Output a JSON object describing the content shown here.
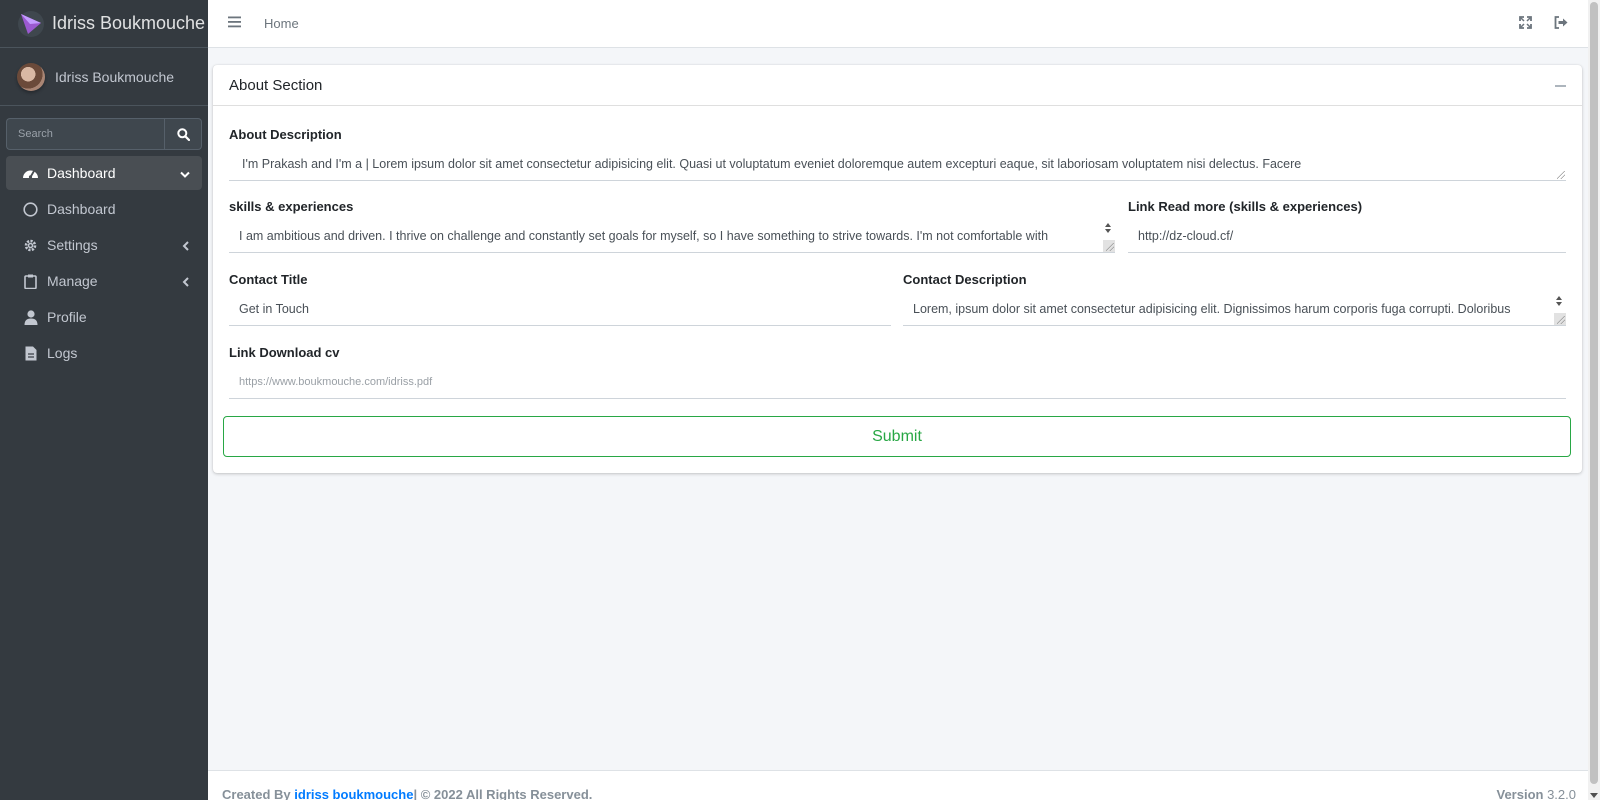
{
  "brand": {
    "name": "Idriss Boukmouche"
  },
  "user": {
    "name": "Idriss Boukmouche"
  },
  "search": {
    "placeholder": "Search"
  },
  "sidebar": {
    "items": [
      {
        "label": "Dashboard",
        "icon": "tachometer-icon",
        "active": true,
        "arrow": "chevron-down"
      },
      {
        "label": "Dashboard",
        "icon": "circle-icon"
      },
      {
        "label": "Settings",
        "icon": "gear-icon",
        "arrow": "chevron-left"
      },
      {
        "label": "Manage",
        "icon": "clipboard-icon",
        "arrow": "chevron-left"
      },
      {
        "label": "Profile",
        "icon": "user-icon"
      },
      {
        "label": "Logs",
        "icon": "file-icon"
      }
    ]
  },
  "topbar": {
    "home": "Home"
  },
  "card": {
    "title": "About Section",
    "about_description": {
      "label": "About Description",
      "value": "I'm Prakash and I'm a | Lorem ipsum dolor sit amet consectetur adipisicing elit. Quasi ut voluptatum eveniet doloremque autem excepturi eaque, sit laboriosam voluptatem nisi delectus. Facere"
    },
    "skills": {
      "label": "skills & experiences",
      "value": "I am ambitious and driven. I thrive on challenge and constantly set goals for myself, so I have something to strive towards. I'm not comfortable with"
    },
    "link_read_more": {
      "label": "Link Read more (skills & experiences)",
      "value": "http://dz-cloud.cf/"
    },
    "contact_title": {
      "label": "Contact Title",
      "value": "Get in Touch"
    },
    "contact_description": {
      "label": "Contact Description",
      "value": "Lorem, ipsum dolor sit amet consectetur adipisicing elit. Dignissimos harum corporis fuga corrupti. Doloribus"
    },
    "link_download_cv": {
      "label": "Link Download cv",
      "placeholder": "https://www.boukmouche.com/idriss.pdf"
    },
    "submit_label": "Submit"
  },
  "footer": {
    "created_by": "Created By",
    "author": "idriss boukmouche",
    "rights": "| © 2022 All Rights Reserved.",
    "version_label": "Version",
    "version": "3.2.0"
  },
  "colors": {
    "sidebar": "#343a40",
    "accent_green": "#28a745",
    "link_blue": "#007bff"
  }
}
